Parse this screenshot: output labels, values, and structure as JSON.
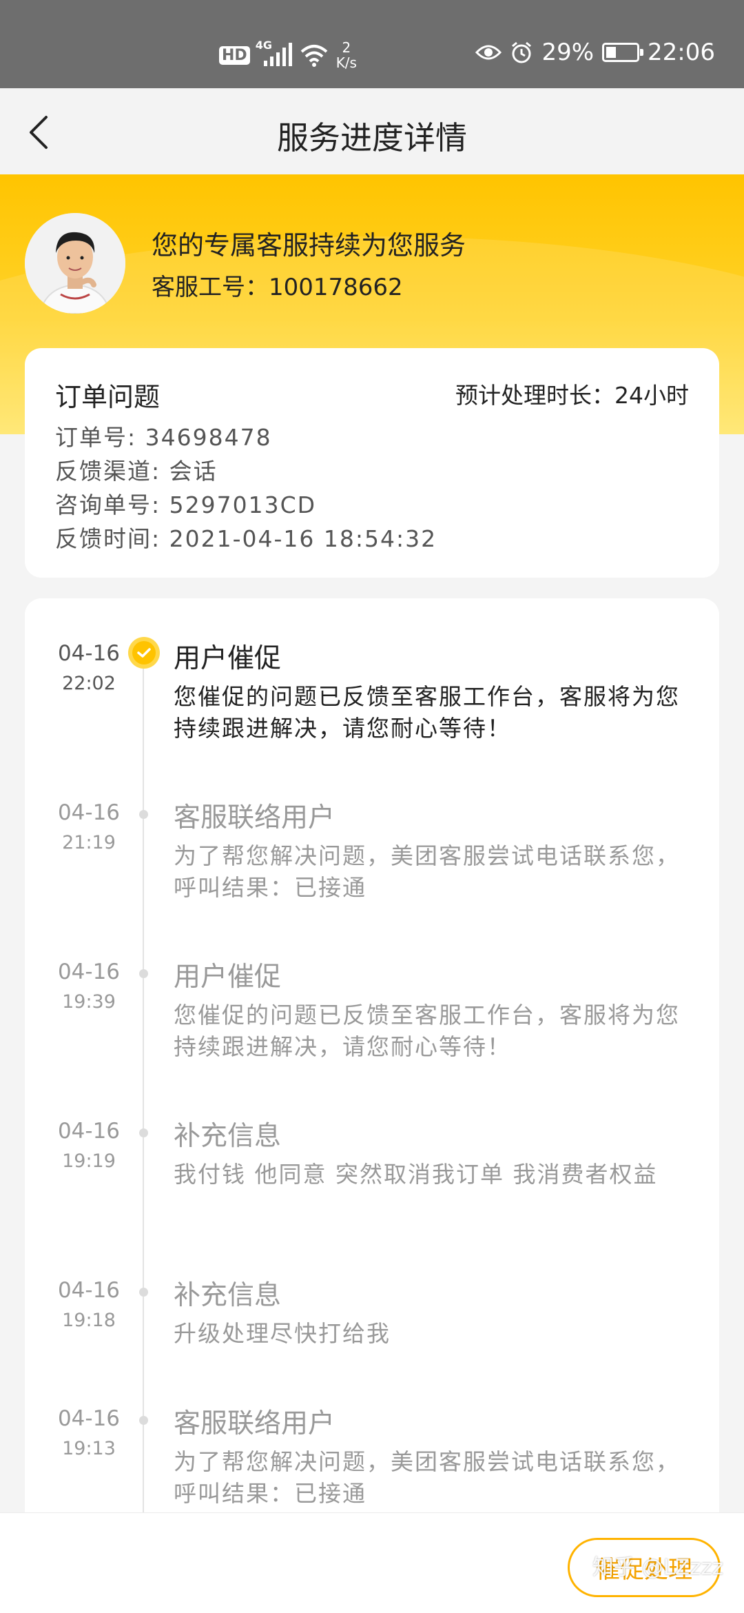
{
  "status_bar": {
    "hd": "HD",
    "network": "4G",
    "speed_value": "2",
    "speed_unit": "K/s",
    "battery": "29%",
    "battery_level": 0.29,
    "time": "22:06"
  },
  "nav": {
    "title": "服务进度详情"
  },
  "agent": {
    "title": "您的专属客服持续为您服务",
    "id_text": "客服工号：100178662"
  },
  "order": {
    "title": "订单问题",
    "estimate": "预计处理时长：24小时",
    "lines": [
      "订单号: 34698478",
      "反馈渠道: 会话",
      "咨询单号: 5297013CD",
      "反馈时间: 2021-04-16 18:54:32"
    ]
  },
  "timeline": [
    {
      "date": "04-16",
      "time": "22:02",
      "title": "用户催促",
      "desc": "您催促的问题已反馈至客服工作台，客服将为您持续跟进解决，请您耐心等待！"
    },
    {
      "date": "04-16",
      "time": "21:19",
      "title": "客服联络用户",
      "desc": "为了帮您解决问题，美团客服尝试电话联系您，呼叫结果：已接通"
    },
    {
      "date": "04-16",
      "time": "19:39",
      "title": "用户催促",
      "desc": "您催促的问题已反馈至客服工作台，客服将为您持续跟进解决，请您耐心等待！"
    },
    {
      "date": "04-16",
      "time": "19:19",
      "title": "补充信息",
      "desc": "我付钱 他同意 突然取消我订单  我消费者权益"
    },
    {
      "date": "04-16",
      "time": "19:18",
      "title": "补充信息",
      "desc": "升级处理尽快打给我"
    },
    {
      "date": "04-16",
      "time": "19:13",
      "title": "客服联络用户",
      "desc": "为了帮您解决问题，美团客服尝试电话联系您，呼叫结果：已接通"
    }
  ],
  "bottom": {
    "urge_label": "催促处理"
  },
  "watermark": "知乎 @LZzzz"
}
